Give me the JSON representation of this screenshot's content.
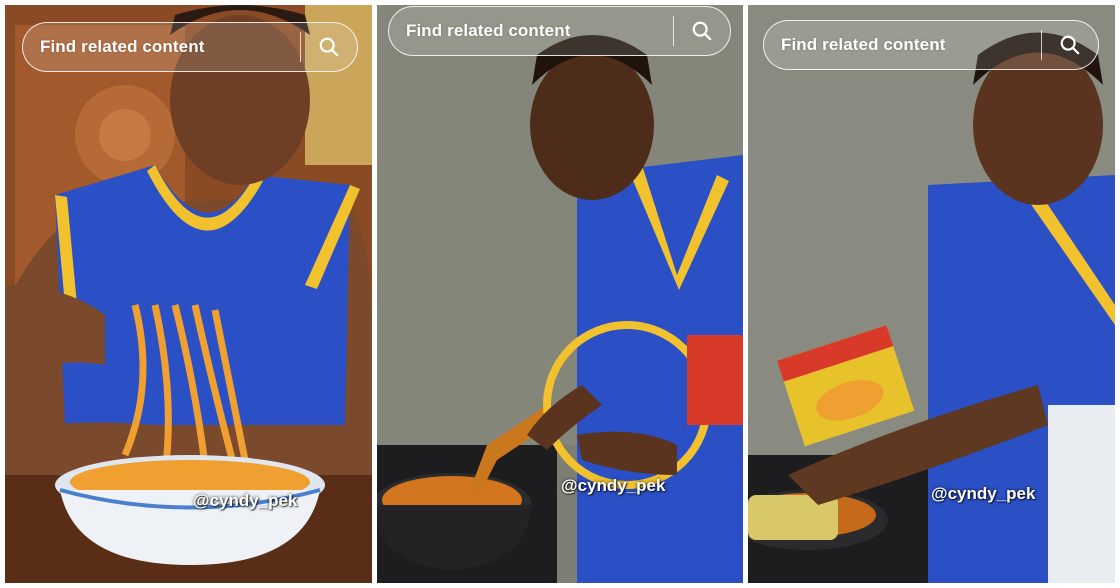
{
  "panels": [
    {
      "search_placeholder": "Find related content",
      "search_icon": "search-icon",
      "watermark": "@cyndy_pek"
    },
    {
      "search_placeholder": "Find related content",
      "search_icon": "search-icon",
      "watermark": "@cyndy_pek"
    },
    {
      "search_placeholder": "Find related content",
      "search_icon": "search-icon",
      "watermark": "@cyndy_pek"
    }
  ],
  "colors": {
    "jersey_blue": "#2b4fc4",
    "jersey_trim": "#f2c12e",
    "noodle_orange": "#f0a030",
    "wall_grey": "#7e7f74"
  }
}
